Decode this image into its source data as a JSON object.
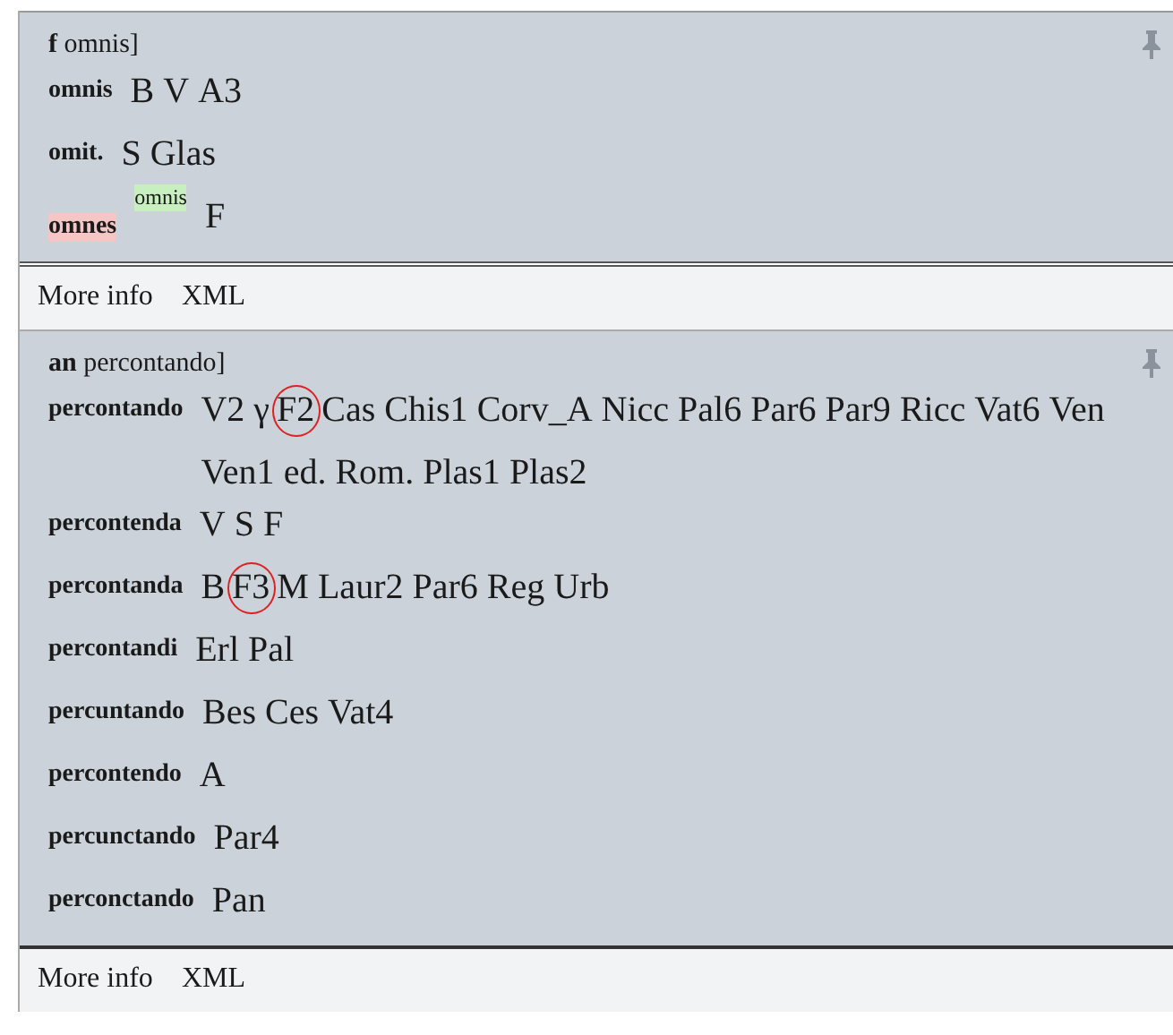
{
  "entries": [
    {
      "lemma": "**f** omnis]",
      "pinned": true,
      "readings": [
        {
          "reading": "omnis",
          "kind": "plain",
          "witnesses": [
            {
              "siglum": "B",
              "circled": false
            },
            {
              "siglum": "V",
              "circled": false
            },
            {
              "siglum": "A3",
              "circled": false
            }
          ]
        },
        {
          "reading": "omit.",
          "kind": "plain",
          "witnesses": [
            {
              "siglum": "S",
              "circled": false
            },
            {
              "siglum": "Glas",
              "circled": false
            }
          ]
        },
        {
          "reading": "omnes",
          "kind": "corrected",
          "correction": "omnis",
          "witnesses": [
            {
              "siglum": "F",
              "circled": false
            }
          ]
        }
      ],
      "links": [
        "More info",
        "XML"
      ]
    },
    {
      "lemma": "**an** percontando]",
      "pinned": true,
      "readings": [
        {
          "reading": "percontando",
          "kind": "plain",
          "witnesses": [
            {
              "siglum": "V2",
              "circled": false
            },
            {
              "siglum": "γ",
              "circled": false
            },
            {
              "siglum": "F2",
              "circled": true
            },
            {
              "siglum": "Cas",
              "circled": false
            },
            {
              "siglum": "Chis1",
              "circled": false
            },
            {
              "siglum": "Corv_A",
              "circled": false
            },
            {
              "siglum": "Nicc",
              "circled": false
            },
            {
              "siglum": "Pal6",
              "circled": false
            },
            {
              "siglum": "Par6",
              "circled": false
            },
            {
              "siglum": "Par9",
              "circled": false
            },
            {
              "siglum": "Ricc",
              "circled": false
            },
            {
              "siglum": "Vat6",
              "circled": false
            },
            {
              "siglum": "Ven",
              "circled": false
            },
            {
              "siglum": "Ven1",
              "circled": false
            },
            {
              "siglum": "ed. Rom.",
              "circled": false
            },
            {
              "siglum": "Plas1",
              "circled": false
            },
            {
              "siglum": "Plas2",
              "circled": false
            }
          ]
        },
        {
          "reading": "percontenda",
          "kind": "plain",
          "witnesses": [
            {
              "siglum": "V",
              "circled": false
            },
            {
              "siglum": "S",
              "circled": false
            },
            {
              "siglum": "F",
              "circled": false
            }
          ]
        },
        {
          "reading": "percontanda",
          "kind": "plain",
          "witnesses": [
            {
              "siglum": "B",
              "circled": false
            },
            {
              "siglum": "F3",
              "circled": true
            },
            {
              "siglum": "M",
              "circled": false
            },
            {
              "siglum": "Laur2",
              "circled": false
            },
            {
              "siglum": "Par6",
              "circled": false
            },
            {
              "siglum": "Reg",
              "circled": false
            },
            {
              "siglum": "Urb",
              "circled": false
            }
          ]
        },
        {
          "reading": "percontandi",
          "kind": "plain",
          "witnesses": [
            {
              "siglum": "Erl",
              "circled": false
            },
            {
              "siglum": "Pal",
              "circled": false
            }
          ]
        },
        {
          "reading": "percuntando",
          "kind": "plain",
          "witnesses": [
            {
              "siglum": "Bes",
              "circled": false
            },
            {
              "siglum": "Ces",
              "circled": false
            },
            {
              "siglum": "Vat4",
              "circled": false
            }
          ]
        },
        {
          "reading": "percontendo",
          "kind": "plain",
          "witnesses": [
            {
              "siglum": "A",
              "circled": false
            }
          ]
        },
        {
          "reading": "percunctando",
          "kind": "plain",
          "witnesses": [
            {
              "siglum": "Par4",
              "circled": false
            }
          ]
        },
        {
          "reading": "perconctando",
          "kind": "plain",
          "witnesses": [
            {
              "siglum": "Pan",
              "circled": false
            }
          ]
        }
      ],
      "links": [
        "More info",
        "XML"
      ]
    }
  ]
}
